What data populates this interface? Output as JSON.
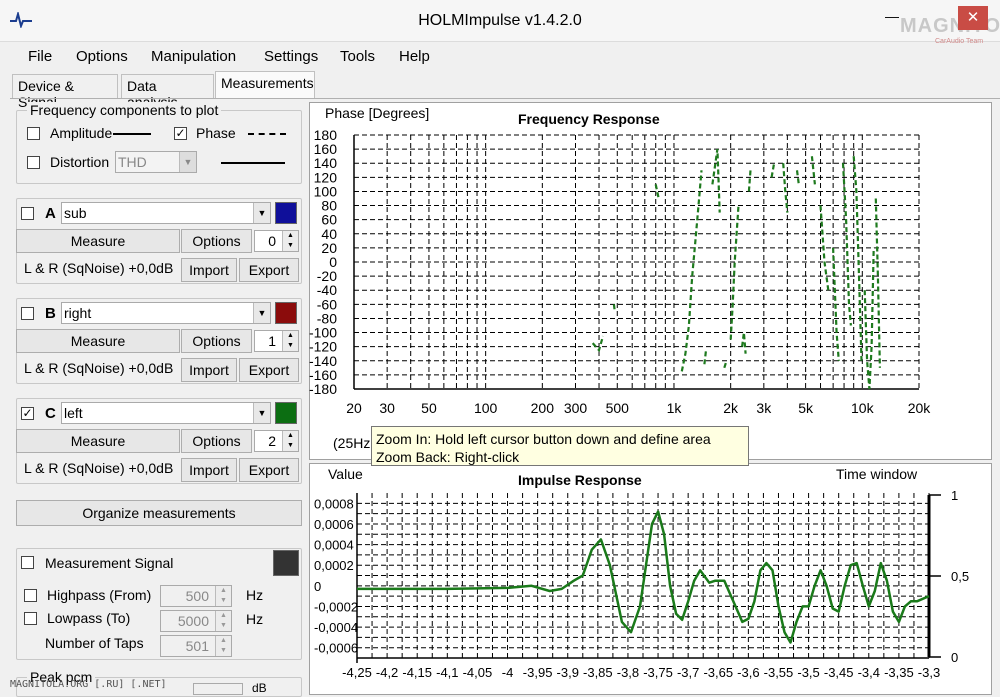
{
  "window": {
    "title": "HOLMImpulse  v1.4.2.0",
    "close_symbol": "✕",
    "minimize_symbol": "—"
  },
  "watermark": {
    "brand": "MAGNITOLA",
    "sub": "CarAudio Team",
    "footer": "MAGNITOLA.ORG  [.RU] [.NET]"
  },
  "menu": [
    "File",
    "Options",
    "Manipulation",
    "Settings",
    "Tools",
    "Help"
  ],
  "tabs": [
    "Device & Signal",
    "Data analysis",
    "Measurements"
  ],
  "freq_components": {
    "title": "Frequency components to plot",
    "amplitude": {
      "label": "Amplitude",
      "checked": false
    },
    "phase": {
      "label": "Phase",
      "checked": true
    },
    "distortion": {
      "label": "Distortion",
      "checked": false,
      "value": "THD"
    }
  },
  "measurements": [
    {
      "letter": "A",
      "checked": false,
      "name": "sub",
      "color": "#0f0f9a",
      "measure": "Measure",
      "options": "Options",
      "spin": "0",
      "info": "L & R (SqNoise) +0,0dB",
      "import": "Import",
      "export": "Export"
    },
    {
      "letter": "B",
      "checked": false,
      "name": "right",
      "color": "#8b0c0c",
      "measure": "Measure",
      "options": "Options",
      "spin": "1",
      "info": "L & R (SqNoise) +0,0dB",
      "import": "Import",
      "export": "Export"
    },
    {
      "letter": "C",
      "checked": true,
      "name": "left",
      "color": "#0c6e12",
      "measure": "Measure",
      "options": "Options",
      "spin": "2",
      "info": "L & R (SqNoise) +0,0dB",
      "import": "Import",
      "export": "Export"
    }
  ],
  "organize_label": "Organize measurements",
  "measurement_signal": {
    "label": "Measurement Signal",
    "checked": false,
    "color": "#333333",
    "highpass": {
      "label": "Highpass (From)",
      "value": "500",
      "unit": "Hz"
    },
    "lowpass": {
      "label": "Lowpass (To)",
      "value": "5000",
      "unit": "Hz"
    },
    "taps": {
      "label": "Number of Taps",
      "value": "501"
    }
  },
  "peak_label": "Peak pcm",
  "peak_unit": "dB",
  "tooltip": {
    "line1": "Zoom In:   Hold left cursor button down and define area",
    "line2": "Zoom Back: Right-click"
  },
  "freq_range_label": "(25Hz",
  "chart_data": [
    {
      "type": "line",
      "title": "Frequency Response",
      "ylabel": "Phase [Degrees]",
      "x_scale": "log",
      "xlim": [
        20,
        20000
      ],
      "ylim": [
        -180,
        180
      ],
      "grid": true,
      "yticks": [
        180,
        160,
        140,
        120,
        100,
        80,
        60,
        40,
        20,
        0,
        -20,
        -40,
        -60,
        -80,
        -100,
        -120,
        -140,
        -160,
        -180
      ],
      "xticks": [
        {
          "v": 20,
          "l": "20"
        },
        {
          "v": 30,
          "l": "30"
        },
        {
          "v": 50,
          "l": "50"
        },
        {
          "v": 100,
          "l": "100"
        },
        {
          "v": 200,
          "l": "200"
        },
        {
          "v": 300,
          "l": "300"
        },
        {
          "v": 500,
          "l": "500"
        },
        {
          "v": 1000,
          "l": "1k"
        },
        {
          "v": 2000,
          "l": "2k"
        },
        {
          "v": 3000,
          "l": "3k"
        },
        {
          "v": 5000,
          "l": "5k"
        },
        {
          "v": 10000,
          "l": "10k"
        },
        {
          "v": 20000,
          "l": "20k"
        }
      ],
      "series": [
        {
          "color": "#1e7a1e",
          "style": "dashed",
          "segments": [
            [
              [
                370,
                -115
              ],
              [
                400,
                -125
              ],
              [
                420,
                -105
              ]
            ],
            [
              [
                480,
                -60
              ],
              [
                485,
                -70
              ]
            ],
            [
              [
                800,
                110
              ],
              [
                830,
                90
              ]
            ],
            [
              [
                1100,
                -155
              ],
              [
                1150,
                -130
              ],
              [
                1200,
                -90
              ],
              [
                1250,
                -20
              ],
              [
                1300,
                30
              ],
              [
                1350,
                80
              ],
              [
                1400,
                130
              ]
            ],
            [
              [
                1450,
                -145
              ],
              [
                1480,
                -125
              ]
            ],
            [
              [
                1600,
                110
              ],
              [
                1700,
                160
              ],
              [
                1750,
                70
              ]
            ],
            [
              [
                1850,
                -150
              ],
              [
                1900,
                -140
              ]
            ],
            [
              [
                2000,
                -110
              ],
              [
                2050,
                -60
              ],
              [
                2100,
                0
              ],
              [
                2150,
                40
              ],
              [
                2200,
                80
              ]
            ],
            [
              [
                2300,
                -120
              ],
              [
                2350,
                -100
              ],
              [
                2400,
                -130
              ]
            ],
            [
              [
                2500,
                100
              ],
              [
                2550,
                130
              ]
            ],
            [
              [
                3300,
                120
              ],
              [
                3400,
                140
              ]
            ],
            [
              [
                3800,
                140
              ],
              [
                3900,
                100
              ],
              [
                4000,
                70
              ]
            ],
            [
              [
                4500,
                130
              ],
              [
                4600,
                110
              ]
            ],
            [
              [
                5400,
                150
              ],
              [
                5600,
                110
              ]
            ],
            [
              [
                6000,
                80
              ],
              [
                6300,
                0
              ],
              [
                6600,
                -40
              ]
            ],
            [
              [
                7000,
                20
              ],
              [
                7300,
                -100
              ],
              [
                7500,
                -140
              ]
            ],
            [
              [
                7900,
                140
              ],
              [
                8200,
                60
              ],
              [
                8500,
                -60
              ],
              [
                8700,
                -90
              ]
            ],
            [
              [
                9000,
                150
              ],
              [
                9300,
                100
              ],
              [
                9600,
                -20
              ],
              [
                9900,
                -140
              ]
            ],
            [
              [
                10300,
                -40
              ],
              [
                10600,
                -140
              ],
              [
                10900,
                -180
              ],
              [
                11200,
                -120
              ],
              [
                11500,
                20
              ]
            ],
            [
              [
                11800,
                90
              ],
              [
                12100,
                -20
              ],
              [
                12400,
                -150
              ]
            ]
          ]
        }
      ]
    },
    {
      "type": "line",
      "title": "Impulse Response",
      "ylabel": "Value",
      "y2label": "Time window",
      "xlim": [
        -4.25,
        -3.3
      ],
      "ylim": [
        -0.007,
        0.009
      ],
      "grid": true,
      "yticks": [
        {
          "v": 0.008,
          "l": "0,0008"
        },
        {
          "v": 0.006,
          "l": "0,0006"
        },
        {
          "v": 0.004,
          "l": "0,0004"
        },
        {
          "v": 0.002,
          "l": "0,0002"
        },
        {
          "v": 0,
          "l": "0"
        },
        {
          "v": -0.002,
          "l": "-0,0002"
        },
        {
          "v": -0.004,
          "l": "-0,0004"
        },
        {
          "v": -0.006,
          "l": "-0,0006"
        }
      ],
      "y2ticks": [
        {
          "v": 1,
          "l": "1"
        },
        {
          "v": 0.5,
          "l": "0,5"
        },
        {
          "v": 0,
          "l": "0"
        }
      ],
      "xticks": [
        {
          "v": -4.25,
          "l": "-4,25"
        },
        {
          "v": -4.2,
          "l": "-4,2"
        },
        {
          "v": -4.15,
          "l": "-4,15"
        },
        {
          "v": -4.1,
          "l": "-4,1"
        },
        {
          "v": -4.05,
          "l": "-4,05"
        },
        {
          "v": -4.0,
          "l": "-4"
        },
        {
          "v": -3.95,
          "l": "-3,95"
        },
        {
          "v": -3.9,
          "l": "-3,9"
        },
        {
          "v": -3.85,
          "l": "-3,85"
        },
        {
          "v": -3.8,
          "l": "-3,8"
        },
        {
          "v": -3.75,
          "l": "-3,75"
        },
        {
          "v": -3.7,
          "l": "-3,7"
        },
        {
          "v": -3.65,
          "l": "-3,65"
        },
        {
          "v": -3.6,
          "l": "-3,6"
        },
        {
          "v": -3.55,
          "l": "-3,55"
        },
        {
          "v": -3.5,
          "l": "-3,5"
        },
        {
          "v": -3.45,
          "l": "-3,45"
        },
        {
          "v": -3.4,
          "l": "-3,4"
        },
        {
          "v": -3.35,
          "l": "-3,35"
        },
        {
          "v": -3.3,
          "l": "-3,3"
        }
      ],
      "series": [
        {
          "color": "#1a7a1a",
          "points": [
            [
              -4.25,
              -0.0003
            ],
            [
              -4.1,
              -0.0003
            ],
            [
              -4.0,
              -0.0002
            ],
            [
              -3.96,
              0.0
            ],
            [
              -3.93,
              -0.0005
            ],
            [
              -3.91,
              -0.0003
            ],
            [
              -3.89,
              0.0005
            ],
            [
              -3.875,
              0.001
            ],
            [
              -3.86,
              0.0035
            ],
            [
              -3.845,
              0.0045
            ],
            [
              -3.83,
              0.002
            ],
            [
              -3.81,
              -0.0035
            ],
            [
              -3.795,
              -0.0045
            ],
            [
              -3.78,
              -0.002
            ],
            [
              -3.77,
              0.002
            ],
            [
              -3.76,
              0.006
            ],
            [
              -3.75,
              0.0072
            ],
            [
              -3.74,
              0.005
            ],
            [
              -3.73,
              0.0
            ],
            [
              -3.72,
              -0.0027
            ],
            [
              -3.71,
              -0.0033
            ],
            [
              -3.7,
              -0.0015
            ],
            [
              -3.69,
              0.0005
            ],
            [
              -3.68,
              0.0015
            ],
            [
              -3.665,
              0.0003
            ],
            [
              -3.655,
              0.0005
            ],
            [
              -3.64,
              0.0005
            ],
            [
              -3.625,
              -0.0015
            ],
            [
              -3.61,
              -0.0035
            ],
            [
              -3.6,
              -0.0032
            ],
            [
              -3.59,
              -0.0015
            ],
            [
              -3.58,
              0.0015
            ],
            [
              -3.57,
              0.0022
            ],
            [
              -3.56,
              0.0015
            ],
            [
              -3.55,
              -0.002
            ],
            [
              -3.54,
              -0.0045
            ],
            [
              -3.53,
              -0.0055
            ],
            [
              -3.52,
              -0.0035
            ],
            [
              -3.51,
              -0.002
            ],
            [
              -3.5,
              -0.002
            ],
            [
              -3.49,
              0.0
            ],
            [
              -3.48,
              0.0015
            ],
            [
              -3.47,
              0.0
            ],
            [
              -3.46,
              -0.0022
            ],
            [
              -3.45,
              -0.0025
            ],
            [
              -3.44,
              0.0
            ],
            [
              -3.43,
              0.002
            ],
            [
              -3.42,
              0.0022
            ],
            [
              -3.41,
              0.0
            ],
            [
              -3.4,
              -0.002
            ],
            [
              -3.39,
              -0.0005
            ],
            [
              -3.38,
              0.0022
            ],
            [
              -3.37,
              0.0005
            ],
            [
              -3.36,
              -0.0025
            ],
            [
              -3.35,
              -0.0035
            ],
            [
              -3.34,
              -0.002
            ],
            [
              -3.33,
              -0.0015
            ],
            [
              -3.32,
              -0.0015
            ],
            [
              -3.3,
              -0.001
            ]
          ]
        }
      ],
      "time_window": {
        "color": "#000000",
        "points": [
          [
            -3.3,
            1
          ],
          [
            -3.3,
            0
          ]
        ]
      }
    }
  ]
}
